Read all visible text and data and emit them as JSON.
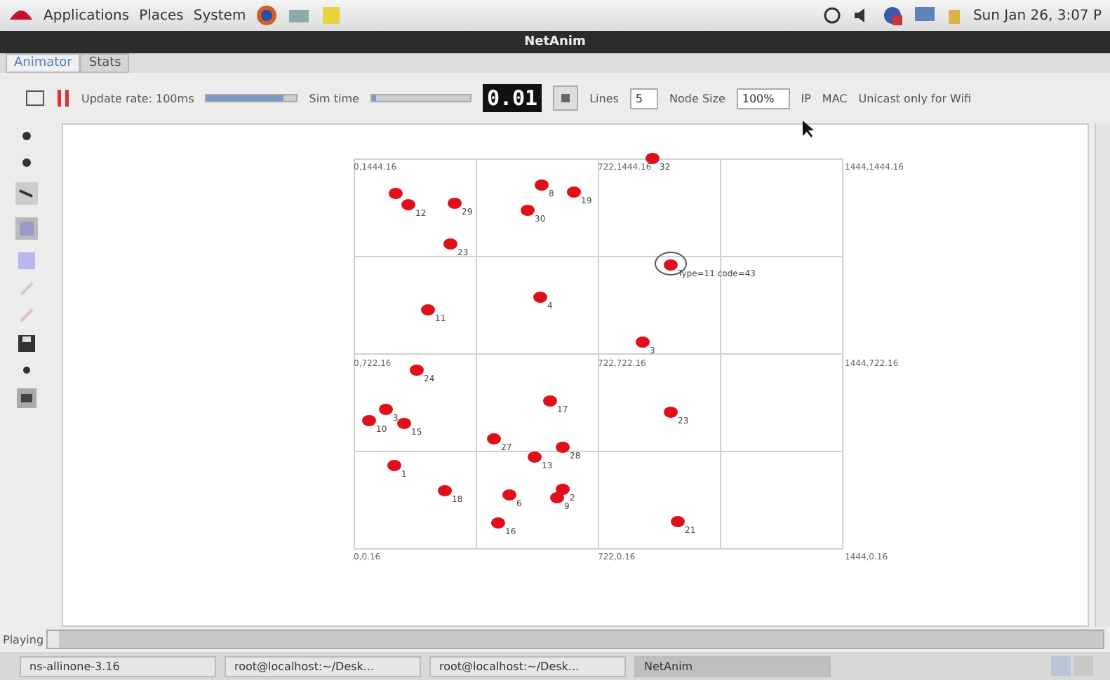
{
  "top_panel": {
    "menus": [
      "Applications",
      "Places",
      "System"
    ],
    "clock": "Sun Jan 26,  3:07 P"
  },
  "window": {
    "title": "NetAnim"
  },
  "tabs": [
    {
      "label": "Animator",
      "selected": true
    },
    {
      "label": "Stats",
      "selected": false
    }
  ],
  "toolbar": {
    "update_rate": "Update rate: 100ms",
    "update_slider": {
      "level": 0.85
    },
    "sim_time_label": "Sim time",
    "sim_slider": {
      "level": 0.05
    },
    "time_display": "0.01",
    "lines_label": "Lines",
    "lines_value": "5",
    "node_size_label": "Node Size",
    "node_size_value": "100%",
    "ip": "IP",
    "mac": "MAC",
    "unicast": "Unicast only for Wifi"
  },
  "canvas": {
    "corner_labels": [
      "0,1444.16",
      "722,1444.16",
      "1444,1444.16",
      "0,722.16",
      "722,722.16",
      "1444,722.16",
      "0,0.16",
      "722,0.16",
      "1444,0.16"
    ],
    "nodes": [
      {
        "kind": "node"
      },
      {
        "kind": "node",
        "label": "12"
      },
      {
        "kind": "node",
        "label": "29"
      },
      {
        "kind": "node",
        "label": "23"
      },
      {
        "kind": "node",
        "label": "8"
      },
      {
        "kind": "node",
        "label": "19"
      },
      {
        "kind": "node",
        "label": "30"
      },
      {
        "kind": "node",
        "label": "32"
      },
      {
        "kind": "node",
        "label": "Type=11 code=43"
      },
      {
        "kind": "node",
        "label": "11"
      },
      {
        "kind": "node",
        "label": "4"
      },
      {
        "kind": "node",
        "label": "3"
      },
      {
        "kind": "node",
        "label": "24"
      },
      {
        "kind": "node",
        "label": "3"
      },
      {
        "kind": "node",
        "label": "10"
      },
      {
        "kind": "node",
        "label": "15"
      },
      {
        "kind": "node",
        "label": "17"
      },
      {
        "kind": "node",
        "label": "23"
      },
      {
        "kind": "node",
        "label": "27"
      },
      {
        "kind": "node",
        "label": "13"
      },
      {
        "kind": "node",
        "label": "28"
      },
      {
        "kind": "node",
        "label": "1"
      },
      {
        "kind": "node",
        "label": "18"
      },
      {
        "kind": "node",
        "label": "6"
      },
      {
        "kind": "node",
        "label": "2"
      },
      {
        "kind": "node",
        "label": "9"
      },
      {
        "kind": "node",
        "label": "16"
      },
      {
        "kind": "node",
        "label": "21"
      }
    ]
  },
  "status": {
    "label": "Playing",
    "level": 0.01
  },
  "taskbar": [
    {
      "label": "ns-allinone-3.16",
      "selected": false
    },
    {
      "label": "root@localhost:~/Desk...",
      "selected": false
    },
    {
      "label": "root@localhost:~/Desk...",
      "selected": false
    },
    {
      "label": "NetAnim",
      "selected": true
    }
  ]
}
